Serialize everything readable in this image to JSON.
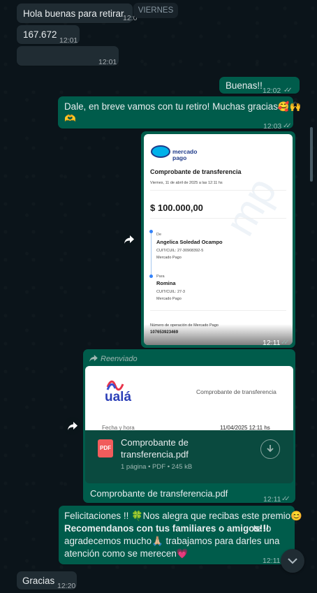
{
  "date_label": "VIERNES",
  "messages": {
    "m1": {
      "text": "Hola buenas para retirar",
      "time": "12:0"
    },
    "m2": {
      "text": "167.672",
      "time": "12:01"
    },
    "m3": {
      "time": "12:01"
    },
    "m4": {
      "text": "Buenas!!",
      "time": "12:02"
    },
    "m5": {
      "text_line1": "Dale, en breve vamos con tu retiro! Muchas gracias🥰🙌",
      "text_line2": "🫶",
      "time": "12:03"
    },
    "m6": {
      "time": "12:11"
    },
    "m7": {
      "forwarded": "Reenviado",
      "caption": "Comprobante de transferencia.pdf",
      "time": "12:11"
    },
    "m8": {
      "line1": "Felicitaciones !! 🍀Nos alegra que recibas este premio😊",
      "line2_bold": "Recomendanos con tus familiares o amigos!!!",
      "line2_rest": " te lo",
      "line3": "agradecemos mucho🙏🏼 trabajamos para darles una",
      "line4": "atención como se merecen💗",
      "time": "12:11"
    },
    "m9": {
      "text": "Gracias",
      "time": "12:20"
    }
  },
  "receipt_mp": {
    "brand_line1": "mercado",
    "brand_line2": "pago",
    "title": "Comprobante de transferencia",
    "date": "Viernes, 11 de abril de 2025 a las 12:11 hs",
    "amount": "$ 100.000,00",
    "from_label": "De",
    "from_name": "Angelica Soledad Ocampo",
    "from_cuit": "CUIT/CUIL: 27-30908392-5",
    "from_bank": "Mercado Pago",
    "to_label": "Para",
    "to_name": "Romina",
    "to_cuit": "CUIT/CUIL: 27-3",
    "to_bank": "Mercado Pago",
    "op_label": "Número de operación de Mercado Pago",
    "op_number": "107653923469"
  },
  "receipt_uala": {
    "brand": "ualá",
    "title": "Comprobante de transferencia",
    "date_label": "Fecha y hora",
    "date_value": "11/04/2025 12:11 hs"
  },
  "pdf": {
    "badge": "PDF",
    "name_line1": "Comprobante de",
    "name_line2": "transferencia.pdf",
    "meta": "1 página • PDF • 245 kB"
  },
  "colors": {
    "incoming": "#202c33",
    "outgoing": "#005c4b",
    "background": "#0b141a"
  }
}
